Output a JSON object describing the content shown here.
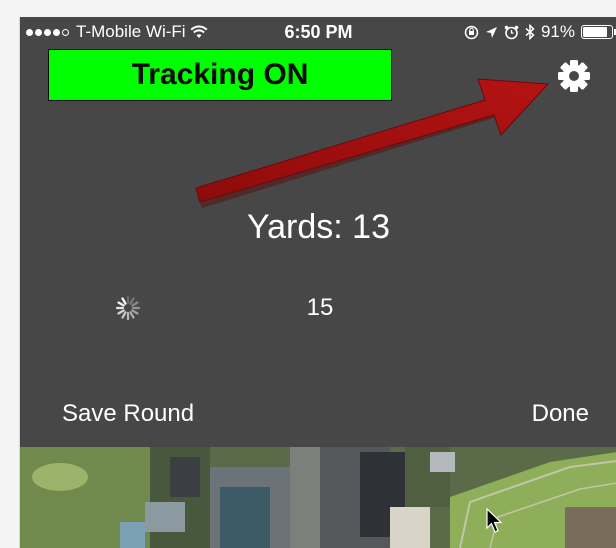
{
  "status_bar": {
    "carrier": "T-Mobile Wi-Fi",
    "time": "6:50 PM",
    "battery": "91%",
    "battery_level": 0.91,
    "signal_dots_filled": 4,
    "signal_dots_total": 5
  },
  "tracking_banner": {
    "label": "Tracking ON",
    "color": "#00ff00"
  },
  "settings": {
    "icon": "gear-icon"
  },
  "annotation": {
    "color": "#a30e0e",
    "icon": "arrow"
  },
  "yards": {
    "label": "Yards: 13"
  },
  "count": {
    "value": "15"
  },
  "actions": {
    "save_round": "Save Round",
    "done": "Done"
  },
  "colors": {
    "background": "#474747",
    "text": "#ffffff"
  }
}
